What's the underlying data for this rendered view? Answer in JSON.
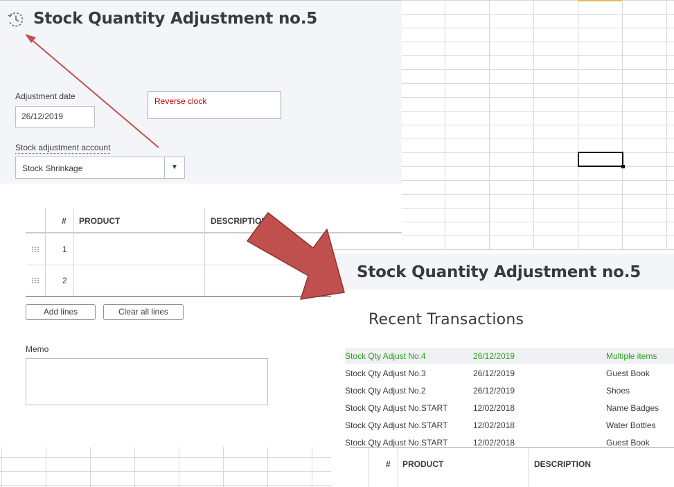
{
  "left": {
    "title": "Stock Quantity Adjustment no.5",
    "date_label": "Adjustment date",
    "date_value": "26/12/2019",
    "annotation": "Reverse clock",
    "account_label": "Stock adjustment account",
    "account_value": "Stock Shrinkage",
    "table": {
      "headers": [
        "#",
        "PRODUCT",
        "DESCRIPTION"
      ],
      "rows": [
        "1",
        "2"
      ]
    },
    "add_lines": "Add lines",
    "clear_lines": "Clear all lines",
    "memo_label": "Memo"
  },
  "right": {
    "title": "Stock Quantity Adjustment no.5",
    "recent_title": "Recent Transactions",
    "transactions": [
      {
        "name": "Stock Qty Adjust No.4",
        "date": "26/12/2019",
        "item": "Multiple items"
      },
      {
        "name": "Stock Qty Adjust No.3",
        "date": "26/12/2019",
        "item": "Guest Book"
      },
      {
        "name": "Stock Qty Adjust No.2",
        "date": "26/12/2019",
        "item": "Shoes"
      },
      {
        "name": "Stock Qty Adjust No.START",
        "date": "12/02/2018",
        "item": "Name Badges"
      },
      {
        "name": "Stock Qty Adjust No.START",
        "date": "12/02/2018",
        "item": "Water Bottles"
      },
      {
        "name": "Stock Qty Adjust No.START",
        "date": "12/02/2018",
        "item": "Guest Book"
      }
    ],
    "table_headers": [
      "#",
      "PRODUCT",
      "DESCRIPTION"
    ]
  },
  "colors": {
    "header_bg": "#f4f5f8",
    "annotation_text": "#c00000",
    "highlight_text": "#2ca01c",
    "arrow": "#c0504d"
  },
  "icons": [
    "history-icon",
    "dropdown-caret-icon",
    "drag-handle-icon",
    "big-arrow-icon",
    "thin-arrow-icon"
  ]
}
